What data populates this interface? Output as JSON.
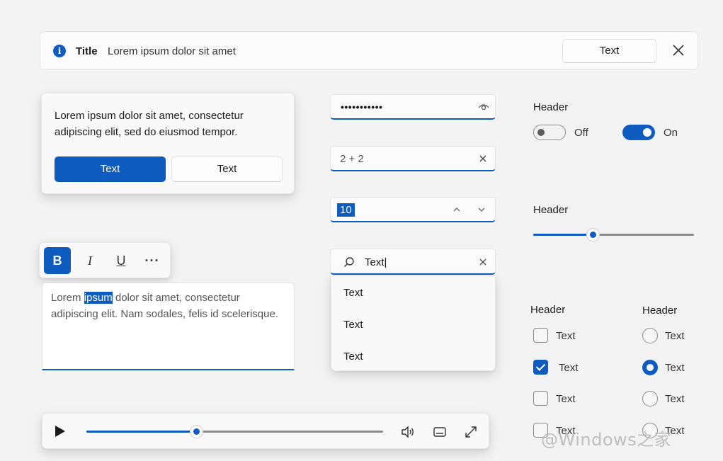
{
  "infobar": {
    "title": "Title",
    "message": "Lorem ipsum dolor sit amet",
    "action_label": "Text"
  },
  "flyout": {
    "text": "Lorem ipsum dolor sit amet, consectetur adipiscing elit, sed do eiusmod tempor.",
    "primary_label": "Text",
    "secondary_label": "Text"
  },
  "toolbar": {
    "bold": "B",
    "italic": "I",
    "underline": "U",
    "more": "···"
  },
  "richedit": {
    "before": "Lorem ",
    "selected": "ipsum",
    "after": " dolor sit amet, consectetur adipiscing elit. Nam sodales, felis id scelerisque."
  },
  "media": {
    "progress": 0.37
  },
  "password": {
    "value": "•••••••••••"
  },
  "calc": {
    "value": "2 + 2"
  },
  "number": {
    "value": "10"
  },
  "search": {
    "value": "Text|",
    "suggestions": [
      "Text",
      "Text",
      "Text"
    ]
  },
  "toggles": {
    "header": "Header",
    "off_label": "Off",
    "on_label": "On"
  },
  "slider": {
    "header": "Header",
    "value": 0.37
  },
  "checkboxes": {
    "header": "Header",
    "items": [
      {
        "label": "Text",
        "checked": false
      },
      {
        "label": "Text",
        "checked": true
      },
      {
        "label": "Text",
        "checked": false
      },
      {
        "label": "Text",
        "checked": false
      }
    ]
  },
  "radios": {
    "header": "Header",
    "items": [
      {
        "label": "Text",
        "checked": false
      },
      {
        "label": "Text",
        "checked": true
      },
      {
        "label": "Text",
        "checked": false
      },
      {
        "label": "Text",
        "checked": false
      }
    ]
  },
  "watermark": "@Windows之家",
  "colors": {
    "accent": "#0f5cc0",
    "background": "#f3f3f3"
  }
}
